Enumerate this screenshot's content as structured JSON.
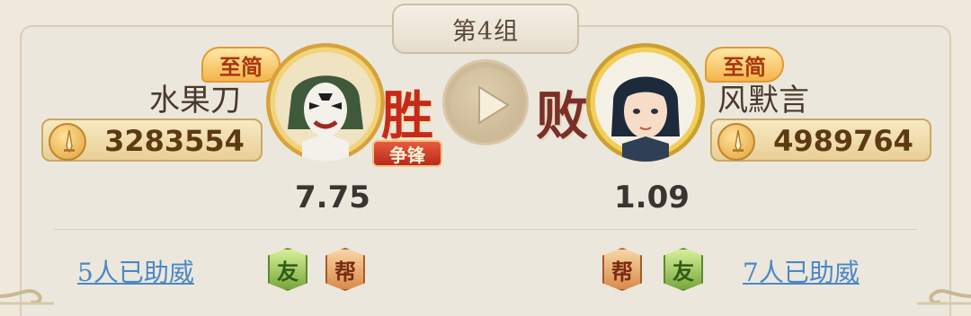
{
  "group": {
    "title": "第4组"
  },
  "left_player": {
    "badge": "至简",
    "name": "水果刀",
    "power": "3283554",
    "result": "胜",
    "tag": "争锋",
    "odds": "7.75",
    "support_text": "5人已助威",
    "chips": [
      "友",
      "帮"
    ]
  },
  "right_player": {
    "badge": "至简",
    "name": "风默言",
    "power": "4989764",
    "result": "败",
    "odds": "1.09",
    "support_text": "7人已助威",
    "chips": [
      "帮",
      "友"
    ]
  },
  "colors": {
    "win": "#c72a1a",
    "lose": "#7a3028",
    "link": "#4a88c8",
    "background": "#efe9dc"
  },
  "icons": {
    "play": "play-icon",
    "power": "sword-icon"
  }
}
